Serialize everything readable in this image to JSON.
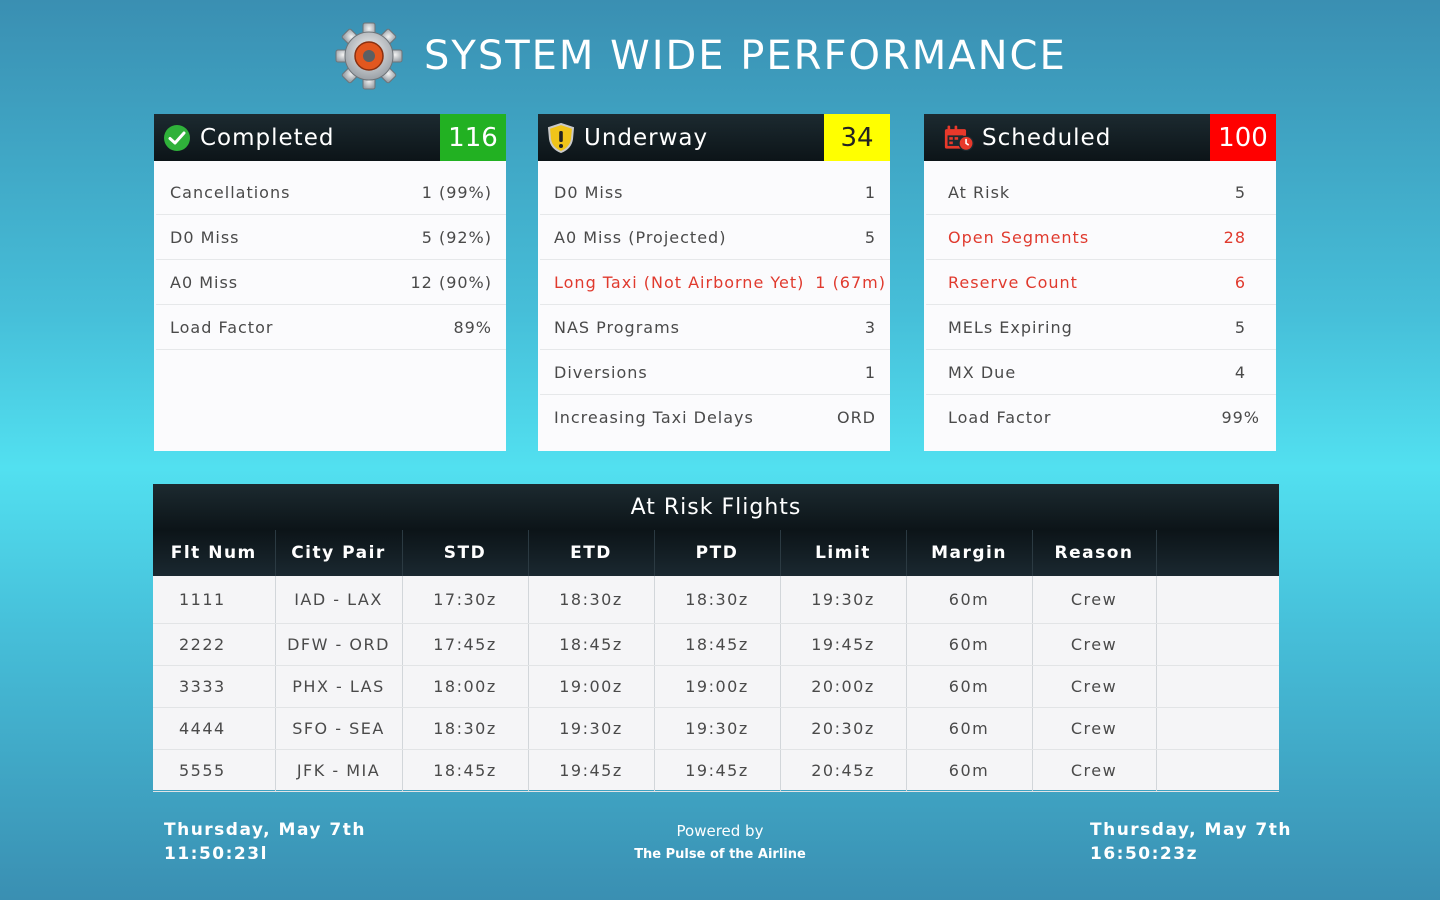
{
  "header": {
    "title": "SYSTEM WIDE PERFORMANCE",
    "icon": "gear-icon"
  },
  "colors": {
    "completed": "#22b122",
    "underway": "#ffff00",
    "scheduled": "#ff0000",
    "alert_text": "#e03a2e"
  },
  "panels": {
    "completed": {
      "label": "Completed",
      "count": "116",
      "icon": "check-circle-icon",
      "rows": [
        {
          "label": "Cancellations",
          "value": "1 (99%)"
        },
        {
          "label": "D0 Miss",
          "value": "5 (92%)"
        },
        {
          "label": "A0 Miss",
          "value": "12 (90%)"
        },
        {
          "label": "Load Factor",
          "value": "89%"
        }
      ]
    },
    "underway": {
      "label": "Underway",
      "count": "34",
      "icon": "shield-warning-icon",
      "rows": [
        {
          "label": "D0 Miss",
          "value": "1"
        },
        {
          "label": "A0 Miss (Projected)",
          "value": "5"
        },
        {
          "label": "Long Taxi (Not Airborne Yet)",
          "value": "1 (67m)"
        },
        {
          "label": "NAS Programs",
          "value": "3"
        },
        {
          "label": "Diversions",
          "value": "1"
        },
        {
          "label": "Increasing Taxi Delays",
          "value": "ORD"
        }
      ]
    },
    "scheduled": {
      "label": "Scheduled",
      "count": "100",
      "icon": "calendar-clock-icon",
      "rows": [
        {
          "label": "At Risk",
          "value": "5"
        },
        {
          "label": "Open Segments",
          "value": "28"
        },
        {
          "label": "Reserve Count",
          "value": "6"
        },
        {
          "label": "MELs Expiring",
          "value": "5"
        },
        {
          "label": "MX Due",
          "value": "4"
        },
        {
          "label": "Load Factor",
          "value": "99%"
        }
      ]
    }
  },
  "flights_table": {
    "title": "At Risk Flights",
    "columns": [
      "Flt Num",
      "City Pair",
      "STD",
      "ETD",
      "PTD",
      "Limit",
      "Margin",
      "Reason",
      ""
    ],
    "rows": [
      [
        "1111",
        "IAD - LAX",
        "17:30z",
        "18:30z",
        "18:30z",
        "19:30z",
        "60m",
        "Crew",
        ""
      ],
      [
        "2222",
        "DFW - ORD",
        "17:45z",
        "18:45z",
        "18:45z",
        "19:45z",
        "60m",
        "Crew",
        ""
      ],
      [
        "3333",
        "PHX - LAS",
        "18:00z",
        "19:00z",
        "19:00z",
        "20:00z",
        "60m",
        "Crew",
        ""
      ],
      [
        "4444",
        "SFO - SEA",
        "18:30z",
        "19:30z",
        "19:30z",
        "20:30z",
        "60m",
        "Crew",
        ""
      ],
      [
        "5555",
        "JFK - MIA",
        "18:45z",
        "19:45z",
        "19:45z",
        "20:45z",
        "60m",
        "Crew",
        ""
      ]
    ]
  },
  "footer": {
    "local_date": "Thursday, May 7th",
    "local_time": "11:50:23l",
    "powered_by": "Powered by",
    "brand": "The Pulse of the Airline",
    "zulu_date": "Thursday, May 7th",
    "zulu_time": "16:50:23z"
  }
}
